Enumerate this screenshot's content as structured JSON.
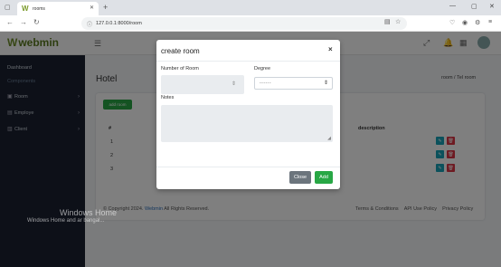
{
  "browser": {
    "tab_title": "rooms",
    "url": "127.0.0.1:8000/room",
    "new_tab_glyph": "+",
    "window_controls": [
      "—",
      "▢",
      "✕"
    ]
  },
  "app": {
    "brand": "webmin",
    "brand_color": "#5b7a1e",
    "sidebar": {
      "items": [
        {
          "label": "Dashboard",
          "icon": "dashboard-icon"
        },
        {
          "label": "Components",
          "icon": "none",
          "is_heading": true
        },
        {
          "label": "Room",
          "icon": "room-icon"
        },
        {
          "label": "Employe",
          "icon": "employee-icon"
        },
        {
          "label": "Client",
          "icon": "client-icon"
        }
      ]
    },
    "page_title": "Hotel",
    "breadcrumb": "room / Tel room",
    "add_button": "add room",
    "table": {
      "headers": [
        "#",
        "description"
      ],
      "rows": [
        "1",
        "2",
        "3"
      ]
    },
    "footer": {
      "copyright_prefix": "© Copyright 2024.",
      "brand": "Webmin",
      "copyright_suffix": "All Rights Reserved.",
      "links": [
        "Terms & Conditions",
        "API Use Policy",
        "Privacy Policy"
      ]
    },
    "watermark": {
      "line1": "Windows Home",
      "line2": "Windows Home and ar bangal..."
    }
  },
  "modal": {
    "title": "create room",
    "close_glyph": "×",
    "fields": {
      "number_of_room": {
        "label": "Number of Room",
        "value": ""
      },
      "degree": {
        "label": "Degree",
        "value": "------"
      },
      "notes": {
        "label": "Notes",
        "value": ""
      }
    },
    "buttons": {
      "close": "Close",
      "add": "Add"
    },
    "colors": {
      "add": "#28a745",
      "close": "#6c757d"
    }
  }
}
